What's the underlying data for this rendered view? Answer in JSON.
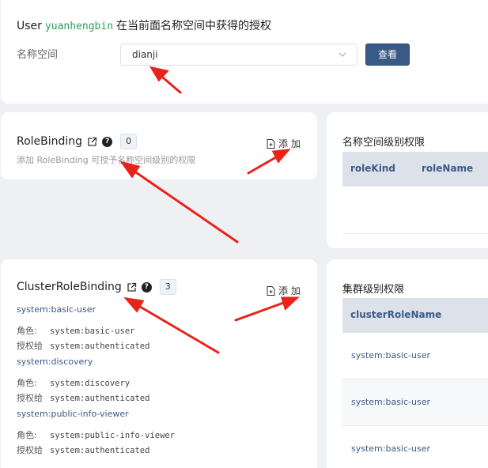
{
  "header": {
    "title_prefix": "User",
    "username": "yuanhengbin",
    "title_suffix": "在当前面名称空间中获得的授权",
    "namespace_label": "名称空间",
    "namespace_value": "dianji",
    "query_label": "查看"
  },
  "rolebinding": {
    "name": "RoleBinding",
    "count": "0",
    "add_label": "添 加",
    "description": "添加 RoleBinding 可授予名称空间级别的权限"
  },
  "clusterrolebinding": {
    "name": "ClusterRoleBinding",
    "count": "3",
    "add_label": "添 加",
    "role_key": "角色:",
    "grant_key": "授权给",
    "entries": [
      {
        "name": "system:basic-user",
        "role": "system:basic-user",
        "grant": "system:authenticated"
      },
      {
        "name": "system:discovery",
        "role": "system:discovery",
        "grant": "system:authenticated"
      },
      {
        "name": "system:public-info-viewer",
        "role": "system:public-info-viewer",
        "grant": "system:authenticated"
      }
    ]
  },
  "namespace_permissions": {
    "title": "名称空间级别权限",
    "columns": [
      "roleKind",
      "roleName"
    ]
  },
  "cluster_permissions": {
    "title": "集群级别权限",
    "column": "clusterRoleName",
    "rows": [
      "system:basic-user",
      "system:basic-user",
      "system:basic-user"
    ]
  },
  "colors": {
    "accent": "#3a5a86",
    "username": "#2e9e5e",
    "annotation_arrow": "#e8231a"
  }
}
